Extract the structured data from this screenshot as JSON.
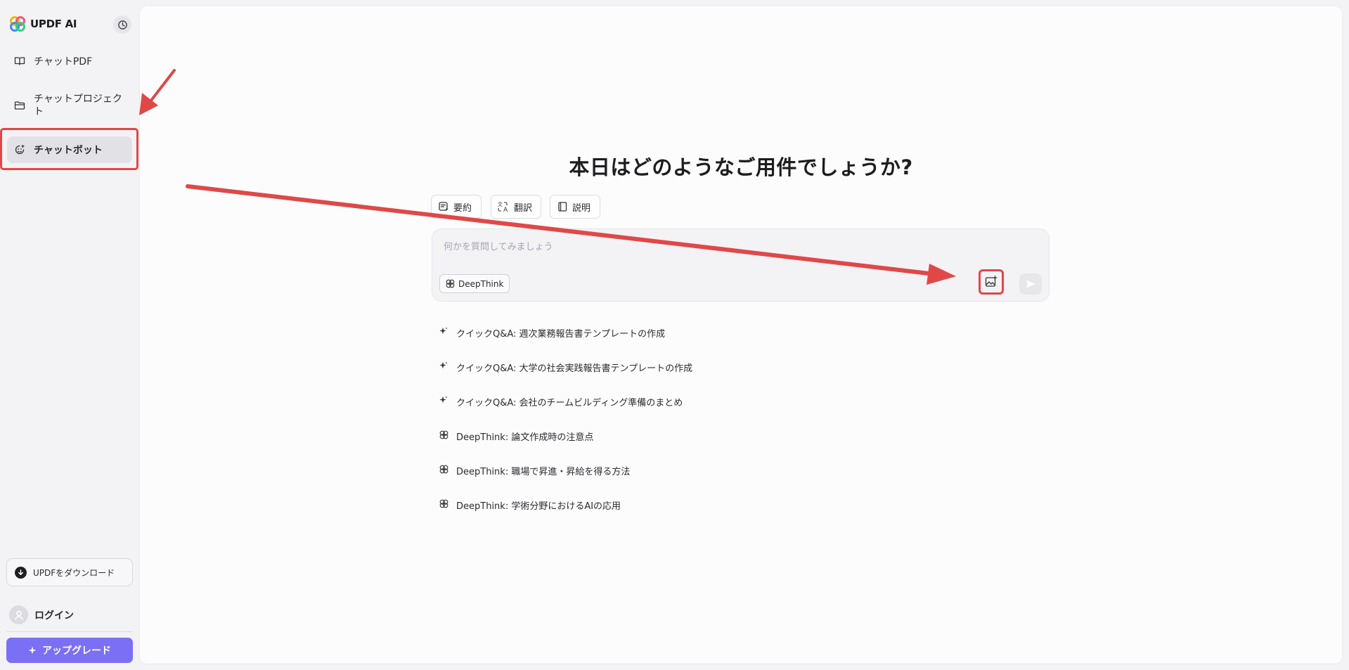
{
  "brand": {
    "name": "UPDF AI"
  },
  "sidebar": {
    "history_icon": "history-clock-icon",
    "items": [
      {
        "label": "チャットPDF",
        "icon": "book-open-icon"
      },
      {
        "label": "チャットプロジェクト",
        "icon": "folder-icon"
      },
      {
        "label": "チャットボット",
        "icon": "bot-face-icon"
      }
    ],
    "download_label": "UPDFをダウンロード",
    "login_label": "ログイン",
    "upgrade_label": "アップグレード"
  },
  "main": {
    "headline": "本日はどのようなご用件でしょうか?",
    "quick_actions": [
      {
        "label": "要約",
        "icon": "summary-icon"
      },
      {
        "label": "翻訳",
        "icon": "translate-icon"
      },
      {
        "label": "説明",
        "icon": "book-icon"
      }
    ],
    "input": {
      "placeholder": "何かを質問してみましょう",
      "value": ""
    },
    "deepthink_label": "DeepThink",
    "suggestions": [
      {
        "icon": "sparkle-icon",
        "text": "クイックQ&A: 週次業務報告書テンプレートの作成"
      },
      {
        "icon": "sparkle-icon",
        "text": "クイックQ&A: 大学の社会実践報告書テンプレートの作成"
      },
      {
        "icon": "sparkle-icon",
        "text": "クイックQ&A: 会社のチームビルディング準備のまとめ"
      },
      {
        "icon": "deepthink-icon",
        "text": "DeepThink: 論文作成時の注意点"
      },
      {
        "icon": "deepthink-icon",
        "text": "DeepThink: 職場で昇進・昇給を得る方法"
      },
      {
        "icon": "deepthink-icon",
        "text": "DeepThink: 学術分野におけるAIの応用"
      }
    ]
  },
  "annotation": {
    "color": "#e04848"
  },
  "colors": {
    "accent": "#7b6ff6",
    "highlight": "#e04848"
  }
}
